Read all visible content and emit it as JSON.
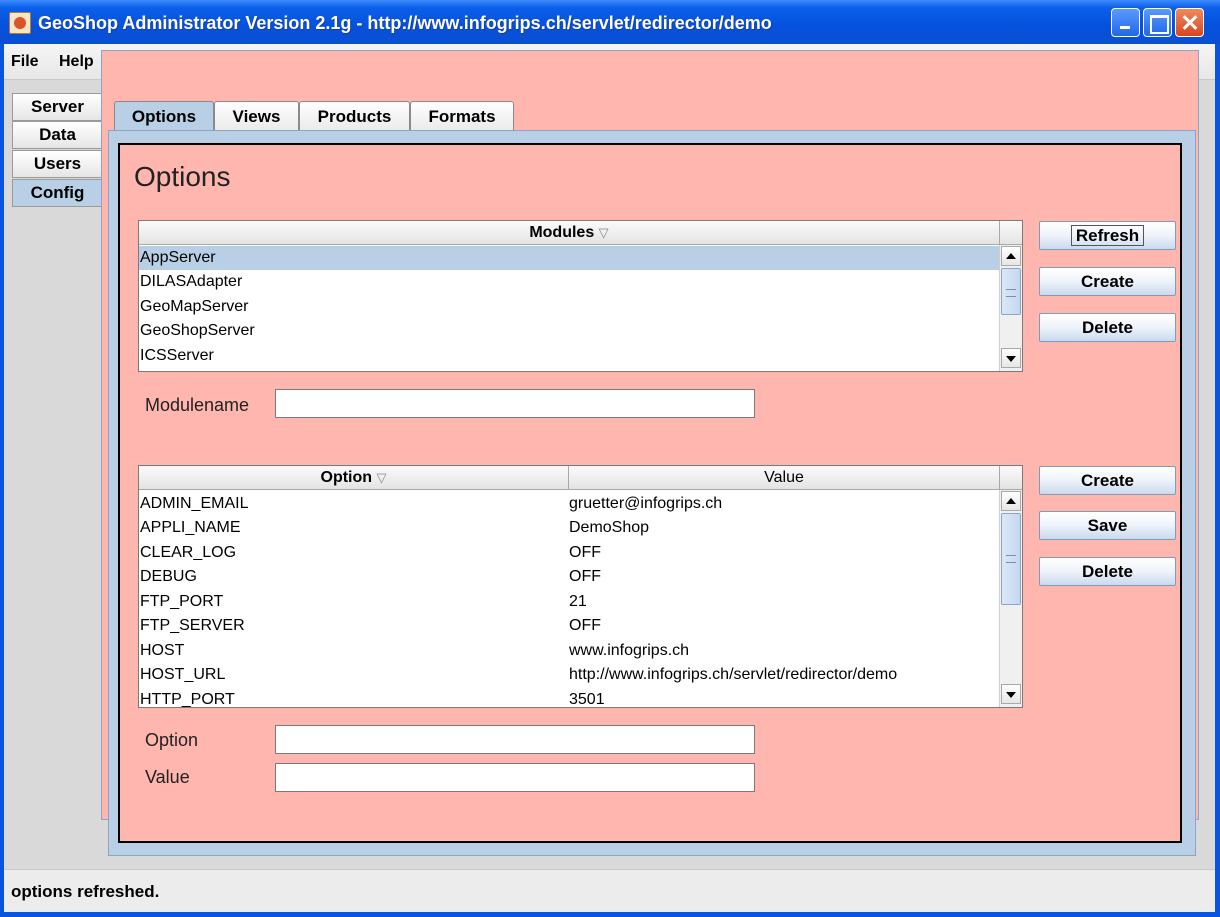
{
  "window": {
    "title": "GeoShop Administrator Version 2.1g - http://www.infogrips.ch/servlet/redirector/demo"
  },
  "menu": [
    "File",
    "Help"
  ],
  "side_tabs": [
    {
      "label": "Server",
      "active": false
    },
    {
      "label": "Data",
      "active": false
    },
    {
      "label": "Users",
      "active": false
    },
    {
      "label": "Config",
      "active": true
    }
  ],
  "top_tabs": [
    {
      "label": "Options",
      "active": true
    },
    {
      "label": "Views",
      "active": false
    },
    {
      "label": "Products",
      "active": false
    },
    {
      "label": "Formats",
      "active": false
    }
  ],
  "page_title": "Options",
  "modules": {
    "header": "Modules",
    "sort_indicator": "▽",
    "rows": [
      "AppServer",
      "DILASAdapter",
      "GeoMapServer",
      "GeoShopServer",
      "ICSServer"
    ],
    "selected_index": 0,
    "buttons": {
      "refresh": "Refresh",
      "create": "Create",
      "delete": "Delete"
    },
    "modulename_label": "Modulename",
    "modulename_value": ""
  },
  "options": {
    "headers": {
      "option": "Option",
      "value": "Value"
    },
    "sort_indicator": "▽",
    "rows": [
      {
        "option": "ADMIN_EMAIL",
        "value": "gruetter@infogrips.ch"
      },
      {
        "option": "APPLI_NAME",
        "value": "DemoShop"
      },
      {
        "option": "CLEAR_LOG",
        "value": "OFF"
      },
      {
        "option": "DEBUG",
        "value": "OFF"
      },
      {
        "option": "FTP_PORT",
        "value": "21"
      },
      {
        "option": "FTP_SERVER",
        "value": "OFF"
      },
      {
        "option": "HOST",
        "value": "www.infogrips.ch"
      },
      {
        "option": "HOST_URL",
        "value": "http://www.infogrips.ch/servlet/redirector/demo"
      },
      {
        "option": "HTTP_PORT",
        "value": "3501"
      }
    ],
    "buttons": {
      "create": "Create",
      "save": "Save",
      "delete": "Delete"
    },
    "option_label": "Option",
    "option_value": "",
    "value_label": "Value",
    "value_value": ""
  },
  "status": "options refreshed."
}
